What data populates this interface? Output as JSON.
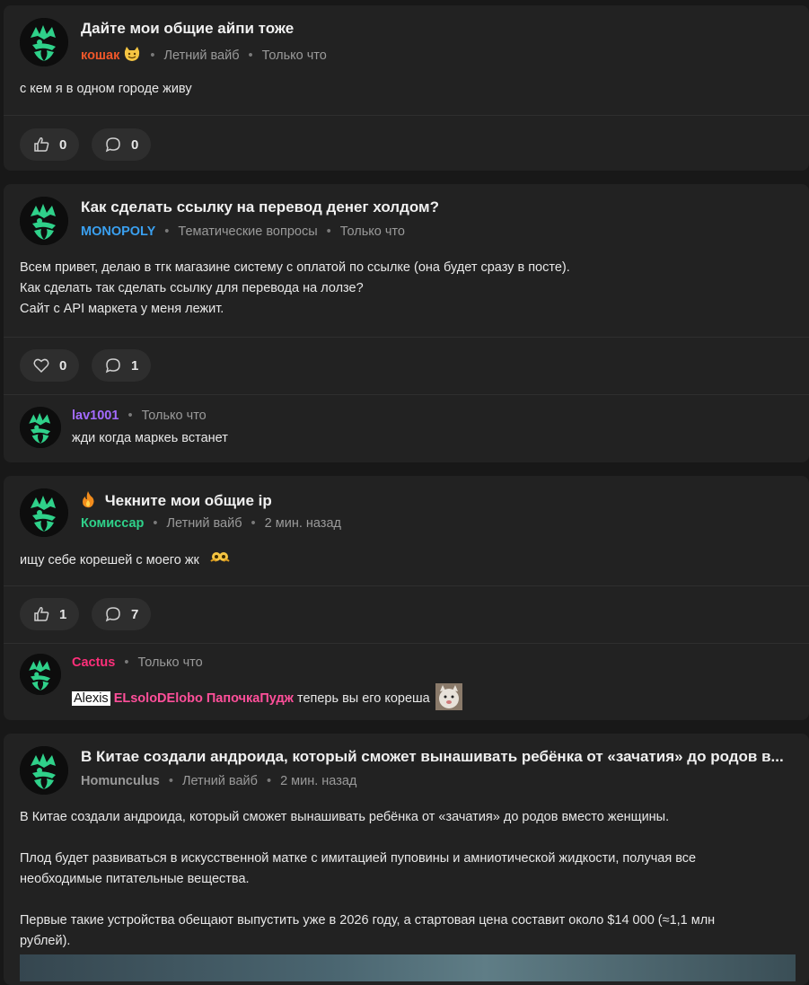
{
  "posts": [
    {
      "title": "Дайте мои общие айпи тоже",
      "author": "кошак",
      "author_color": "#f0572a",
      "author_emoji": "smiling-cat-emoji",
      "category": "Летний вайб",
      "time": "Только что",
      "body": [
        "с кем я в одном городе живу"
      ],
      "likes": "0",
      "like_icon": "thumbs-up-icon",
      "comments": "0"
    },
    {
      "title": "Как сделать ссылку на перевод денег холдом?",
      "author": "MONOPOLY",
      "author_color": "#3aa0f0",
      "category": "Тематические вопросы",
      "time": "Только что",
      "body": [
        "Всем привет, делаю в тгк магазине систему с оплатой по ссылке (она будет сразу в посте).",
        "Как сделать так сделать ссылку для перевода на лолзе?",
        "Сайт с API маркета у меня лежит."
      ],
      "likes": "0",
      "like_icon": "heart-icon",
      "comments": "1",
      "reply": {
        "author": "lav1001",
        "author_color": "#a36bff",
        "time": "Только что",
        "text": "жди когда маркеь встанет"
      }
    },
    {
      "title": "Чекните мои общие ip",
      "title_icon": "fire-icon",
      "author": "Комиссар",
      "author_color": "#2fd18a",
      "category": "Летний вайб",
      "time": "2 мин. назад",
      "body": [
        "ищу себе корешей с моего жк"
      ],
      "body_emoji": "eyes-hands-emoji",
      "likes": "1",
      "like_icon": "thumbs-up-icon",
      "comments": "7",
      "reply": {
        "author": "Cactus",
        "author_color": "#ff2f7a",
        "time": "Только что",
        "mentions": [
          {
            "name": "Alexis",
            "style": "highlight"
          },
          {
            "name": "ELsoloDElobo",
            "color": "#ff4f9a"
          },
          {
            "name": "ПапочкаПудж",
            "color": "#ff4f9a"
          }
        ],
        "text": "теперь вы его кореша",
        "sticker": "cat-sticker"
      }
    },
    {
      "title": "В Китае создали андроида, который сможет вынашивать ребёнка от «зачатия» до родов в...",
      "author": "Homunculus",
      "author_color": "#9a9a9a",
      "category": "Летний вайб",
      "time": "2 мин. назад",
      "body": [
        "В Китае создали андроида, который сможет вынашивать ребёнка от «зачатия» до родов вместо женщины.",
        "",
        "Плод будет развиваться в искусственной матке с имитацией пуповины и амниотической жидкости, получая все",
        "необходимые питательные вещества.",
        "",
        "Первые такие устройства обещают выпустить уже в 2026 году, а стартовая цена составит около $14 000 (≈1,1 млн",
        "рублей)."
      ]
    }
  ]
}
